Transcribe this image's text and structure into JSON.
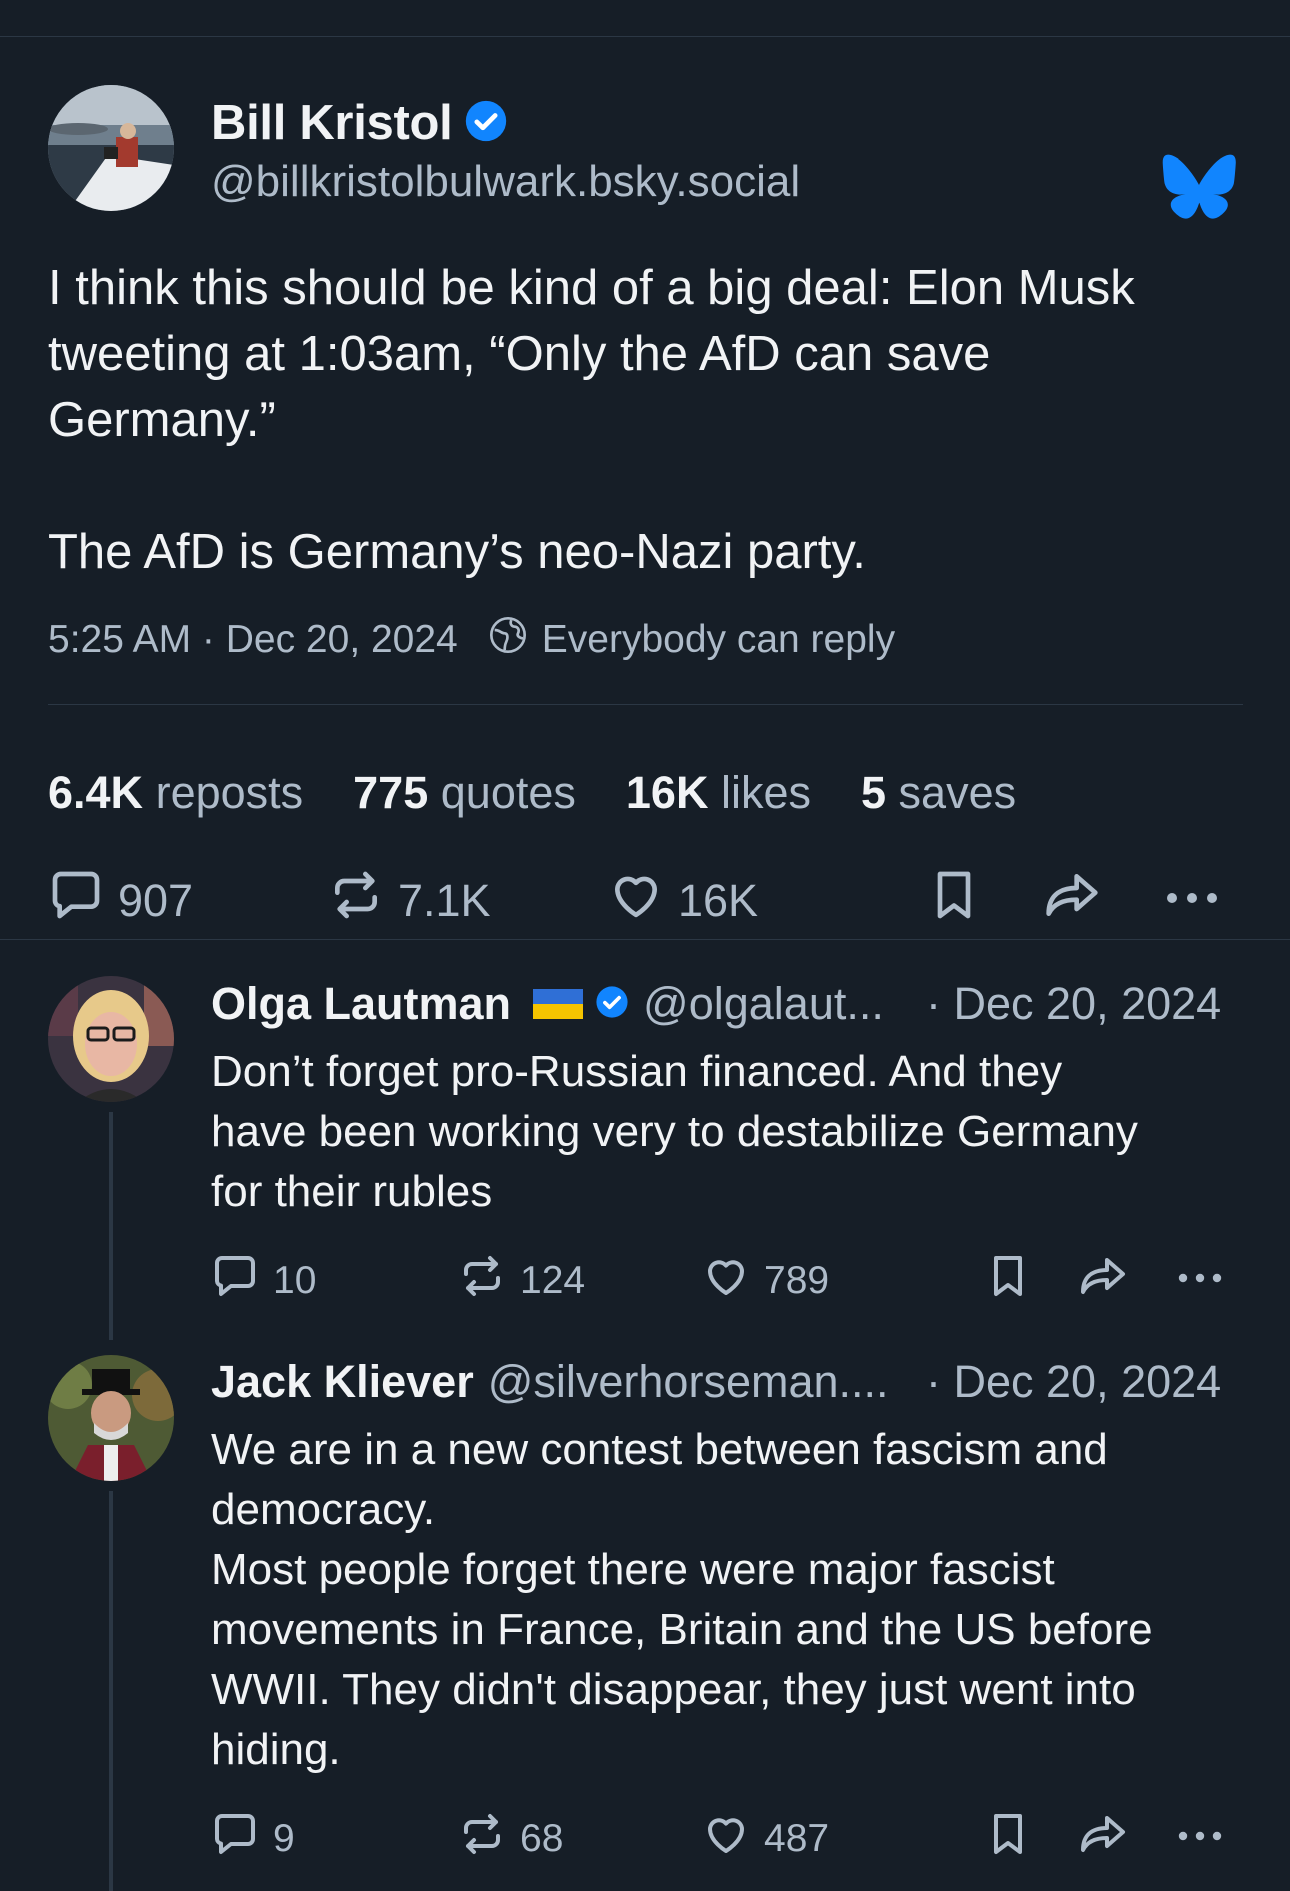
{
  "main_post": {
    "author_name": "Bill Kristol",
    "author_handle": "@billkristolbulwark.bsky.social",
    "text_para1": "I think this should be kind of a big deal: Elon Musk\ntweeting at 1:03am, “Only the AfD can save\nGermany.”",
    "text_para2": "The AfD is Germany’s neo-Nazi party.",
    "time": "5:25 AM · Dec 20, 2024",
    "reply_setting": "Everybody can reply",
    "stats": {
      "reposts_num": "6.4K",
      "reposts_label": "reposts",
      "quotes_num": "775",
      "quotes_label": "quotes",
      "likes_num": "16K",
      "likes_label": "likes",
      "saves_num": "5",
      "saves_label": "saves"
    },
    "actions": {
      "replies": "907",
      "reposts": "7.1K",
      "likes": "16K"
    }
  },
  "replies": [
    {
      "author_name": "Olga Lautman",
      "author_handle": "@olgalaut...",
      "date": "· Dec 20, 2024",
      "text": "Don’t forget pro-Russian financed. And they\nhave been working very to destabilize Germany\nfor their rubles",
      "actions": {
        "replies": "10",
        "reposts": "124",
        "likes": "789"
      }
    },
    {
      "author_name": "Jack Kliever",
      "author_handle": "@silverhorseman....",
      "date": "· Dec 20, 2024",
      "text": "We are in a new contest between fascism and\ndemocracy.\nMost people forget there were major fascist\nmovements in France, Britain and the US before\nWWII. They didn't disappear, they just went into\nhiding.",
      "actions": {
        "replies": "9",
        "reposts": "68",
        "likes": "487"
      }
    }
  ],
  "colors": {
    "background": "#161e27",
    "text_primary": "#f1f3f5",
    "text_secondary": "#aebbc9",
    "divider": "#2b3744",
    "accent_blue": "#1185fe"
  }
}
